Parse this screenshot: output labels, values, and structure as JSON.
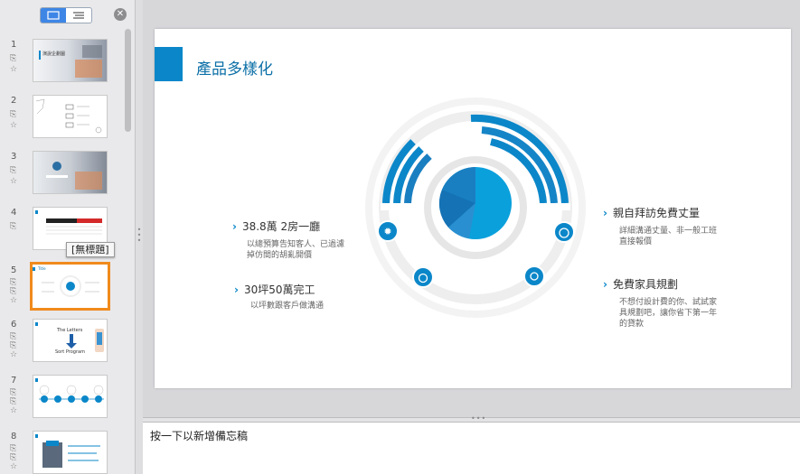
{
  "sidebar": {
    "tooltip": "[無標題]",
    "slides": [
      {
        "num": "1",
        "icons": [
          "slide-link-icon",
          "star-icon"
        ]
      },
      {
        "num": "2",
        "icons": [
          "slide-link-icon",
          "star-icon"
        ]
      },
      {
        "num": "3",
        "icons": [
          "slide-link-icon",
          "star-icon"
        ]
      },
      {
        "num": "4",
        "icons": [
          "slide-link-icon"
        ]
      },
      {
        "num": "5",
        "icons": [
          "slide-link-icon",
          "slide-link-icon",
          "star-icon"
        ]
      },
      {
        "num": "6",
        "icons": [
          "slide-link-icon",
          "slide-link-icon",
          "star-icon"
        ]
      },
      {
        "num": "7",
        "icons": [
          "slide-link-icon",
          "slide-link-icon",
          "star-icon"
        ]
      },
      {
        "num": "8",
        "icons": [
          "slide-link-icon",
          "slide-link-icon",
          "star-icon"
        ]
      }
    ],
    "thumb_texts": {
      "s1": "演說企劃圖",
      "s6a": "The Letters",
      "s6b": "Sort Program",
      "s5label": "Title"
    }
  },
  "slide": {
    "title": "產品多樣化",
    "left1": {
      "title": "38.8萬 2房一廳",
      "body": "以總預算告知客人、已過濾掉仿間的胡亂開價"
    },
    "left2": {
      "title": "30坪50萬完工",
      "body": "以坪數跟客戶做溝通"
    },
    "right1": {
      "title": "親自拜訪免費丈量",
      "body": "詳細溝通丈量、非一般工班直接報價"
    },
    "right2": {
      "title": "免費家具規劃",
      "body": "不想付設計費的你、試試家具規劃吧，讓你省下第一年的貸款"
    },
    "accent": "#0b87c9"
  },
  "notes": {
    "placeholder": "按一下以新增備忘稿"
  }
}
